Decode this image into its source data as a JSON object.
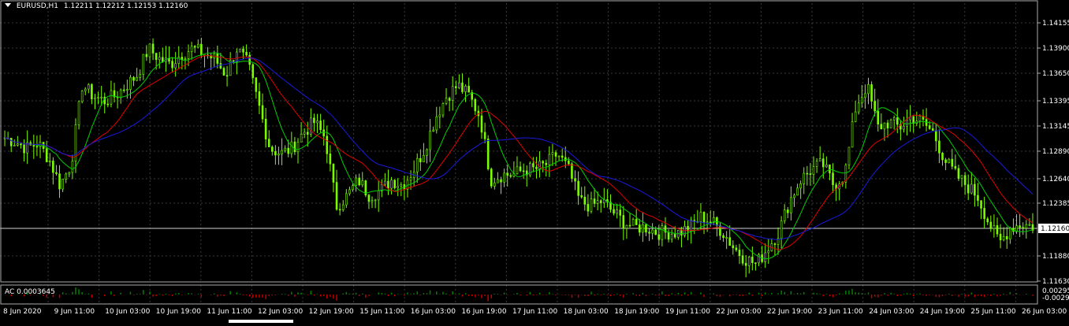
{
  "header": {
    "symbol": "EURUSD,H1",
    "ohlc": "1.12211 1.12212 1.12153 1.12160"
  },
  "price_axis": {
    "labels": [
      "1.14155",
      "1.13900",
      "1.13650",
      "1.13395",
      "1.13145",
      "1.12890",
      "1.12640",
      "1.12385",
      "1.11880",
      "1.11630"
    ],
    "current": "1.12160"
  },
  "indicator": {
    "label": "AC 0.0003645",
    "axis_labels": [
      "0.00295",
      "-0.00297"
    ]
  },
  "time_axis": {
    "labels": [
      "8 Jun 2020",
      "9 Jun 11:00",
      "10 Jun 03:00",
      "10 Jun 19:00",
      "11 Jun 11:00",
      "12 Jun 03:00",
      "12 Jun 19:00",
      "15 Jun 11:00",
      "16 Jun 03:00",
      "16 Jun 19:00",
      "17 Jun 11:00",
      "18 Jun 03:00",
      "18 Jun 19:00",
      "19 Jun 11:00",
      "22 Jun 03:00",
      "22 Jun 19:00",
      "23 Jun 11:00",
      "24 Jun 03:00",
      "24 Jun 19:00",
      "25 Jun 11:00",
      "26 Jun 03:00"
    ]
  },
  "colors": {
    "background": "#000000",
    "grid": "#3a3a3a",
    "candles": "#7CFC00",
    "ma_fast": "#00d000",
    "ma_mid": "#e00000",
    "ma_slow": "#1a1ae0",
    "ac_up": "#008000",
    "ac_down": "#c00000",
    "text": "#ffffff"
  },
  "chart_data": {
    "type": "candlestick",
    "symbol": "EURUSD",
    "timeframe": "H1",
    "ylim": [
      1.1163,
      1.1428
    ],
    "series": [
      {
        "name": "EURUSD",
        "values": [
          1.13,
          1.1296,
          1.129,
          1.1295,
          1.128,
          1.1255,
          1.1275,
          1.135,
          1.134,
          1.1335,
          1.134,
          1.135,
          1.136,
          1.1385,
          1.1375,
          1.137,
          1.138,
          1.1385,
          1.138,
          1.1375,
          1.136,
          1.1385,
          1.137,
          1.133,
          1.129,
          1.1285,
          1.129,
          1.1305,
          1.1315,
          1.13,
          1.1235,
          1.1245,
          1.126,
          1.1245,
          1.125,
          1.126,
          1.1255,
          1.127,
          1.129,
          1.132,
          1.134,
          1.135,
          1.134,
          1.132,
          1.126,
          1.1265,
          1.1265,
          1.127,
          1.127,
          1.1275,
          1.1285,
          1.127,
          1.124,
          1.1235,
          1.124,
          1.123,
          1.122,
          1.1215,
          1.1215,
          1.121,
          1.121,
          1.121,
          1.1215,
          1.1225,
          1.122,
          1.121,
          1.1195,
          1.1185,
          1.118,
          1.1195,
          1.121,
          1.124,
          1.126,
          1.127,
          1.1275,
          1.1255,
          1.1265,
          1.133,
          1.135,
          1.131,
          1.1315,
          1.131,
          1.132,
          1.1315,
          1.1305,
          1.128,
          1.1265,
          1.1255,
          1.1245,
          1.122,
          1.12,
          1.1215,
          1.1218,
          1.1216
        ]
      }
    ]
  }
}
